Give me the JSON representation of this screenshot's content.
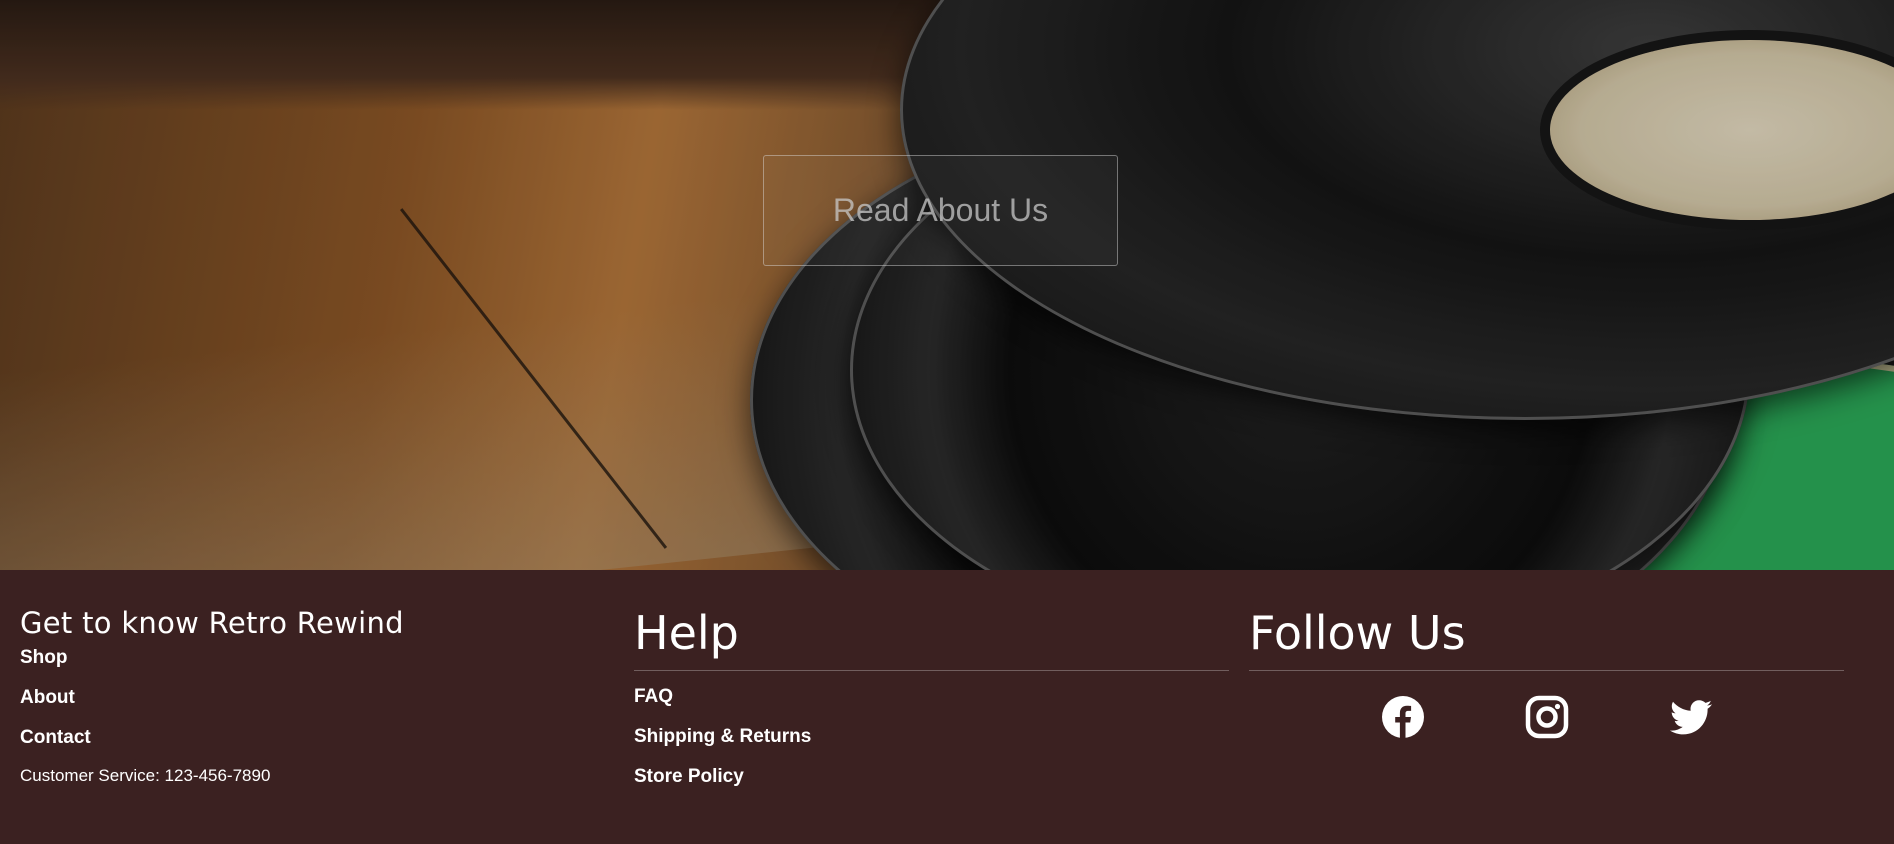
{
  "hero": {
    "button_label": "Read About Us"
  },
  "footer": {
    "about_column": {
      "title": "Get to know Retro Rewind",
      "links": [
        "Shop",
        "About",
        "Contact"
      ],
      "customer_service": "Customer Service: 123-456-7890"
    },
    "help_column": {
      "title": "Help",
      "links": [
        "FAQ",
        "Shipping & Returns",
        "Store Policy"
      ]
    },
    "follow_column": {
      "title": "Follow Us",
      "social_icons": [
        "facebook-icon",
        "instagram-icon",
        "twitter-icon"
      ]
    }
  },
  "colors": {
    "footer_background": "#3b2121",
    "text": "#ffffff"
  }
}
